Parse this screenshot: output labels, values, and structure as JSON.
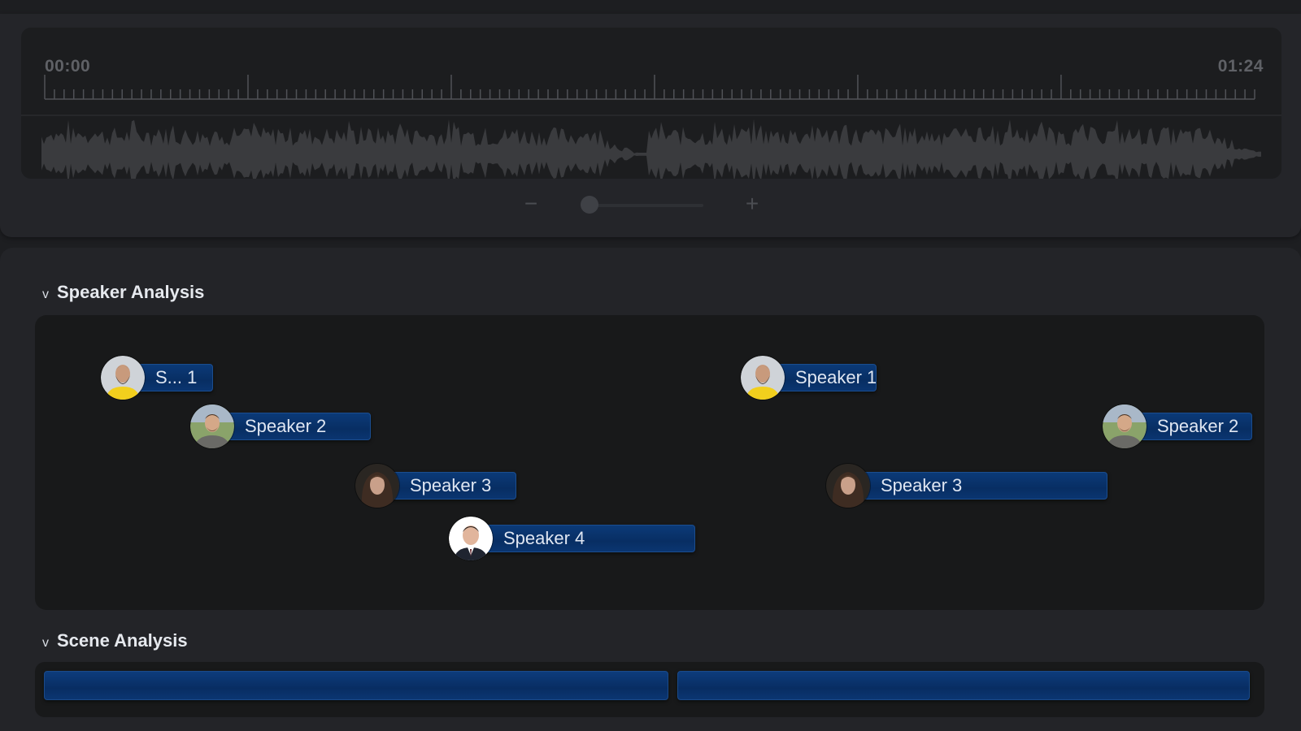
{
  "timeline": {
    "start_time": "00:00",
    "end_time": "01:24",
    "zoom": {
      "minus_label": "−",
      "plus_label": "+",
      "level": 0.0
    }
  },
  "speaker_analysis": {
    "chevron": "v",
    "title": "Speaker Analysis",
    "segments": [
      {
        "label": "S... 1",
        "speaker": "speaker-1",
        "avatar": "bearded-man-yellow-shirt"
      },
      {
        "label": "Speaker 2",
        "speaker": "speaker-2",
        "avatar": "young-man-grey-shirt"
      },
      {
        "label": "Speaker 3",
        "speaker": "speaker-3",
        "avatar": "woman-dark-hair"
      },
      {
        "label": "Speaker 4",
        "speaker": "speaker-4",
        "avatar": "man-suit-tie"
      },
      {
        "label": "Speaker 1",
        "speaker": "speaker-1",
        "avatar": "bearded-man-yellow-shirt"
      },
      {
        "label": "Speaker 3",
        "speaker": "speaker-3",
        "avatar": "woman-dark-hair"
      },
      {
        "label": "Speaker 2",
        "speaker": "speaker-2",
        "avatar": "young-man-grey-shirt"
      }
    ]
  },
  "scene_analysis": {
    "chevron": "v",
    "title": "Scene Analysis",
    "scene_count": 2
  },
  "colors": {
    "background": "#1d1e21",
    "panel": "#232428",
    "track": "#18191a",
    "segment_blue": "#0b3a78",
    "waveform": "#3a3b3e",
    "text": "#e6e9ee"
  }
}
